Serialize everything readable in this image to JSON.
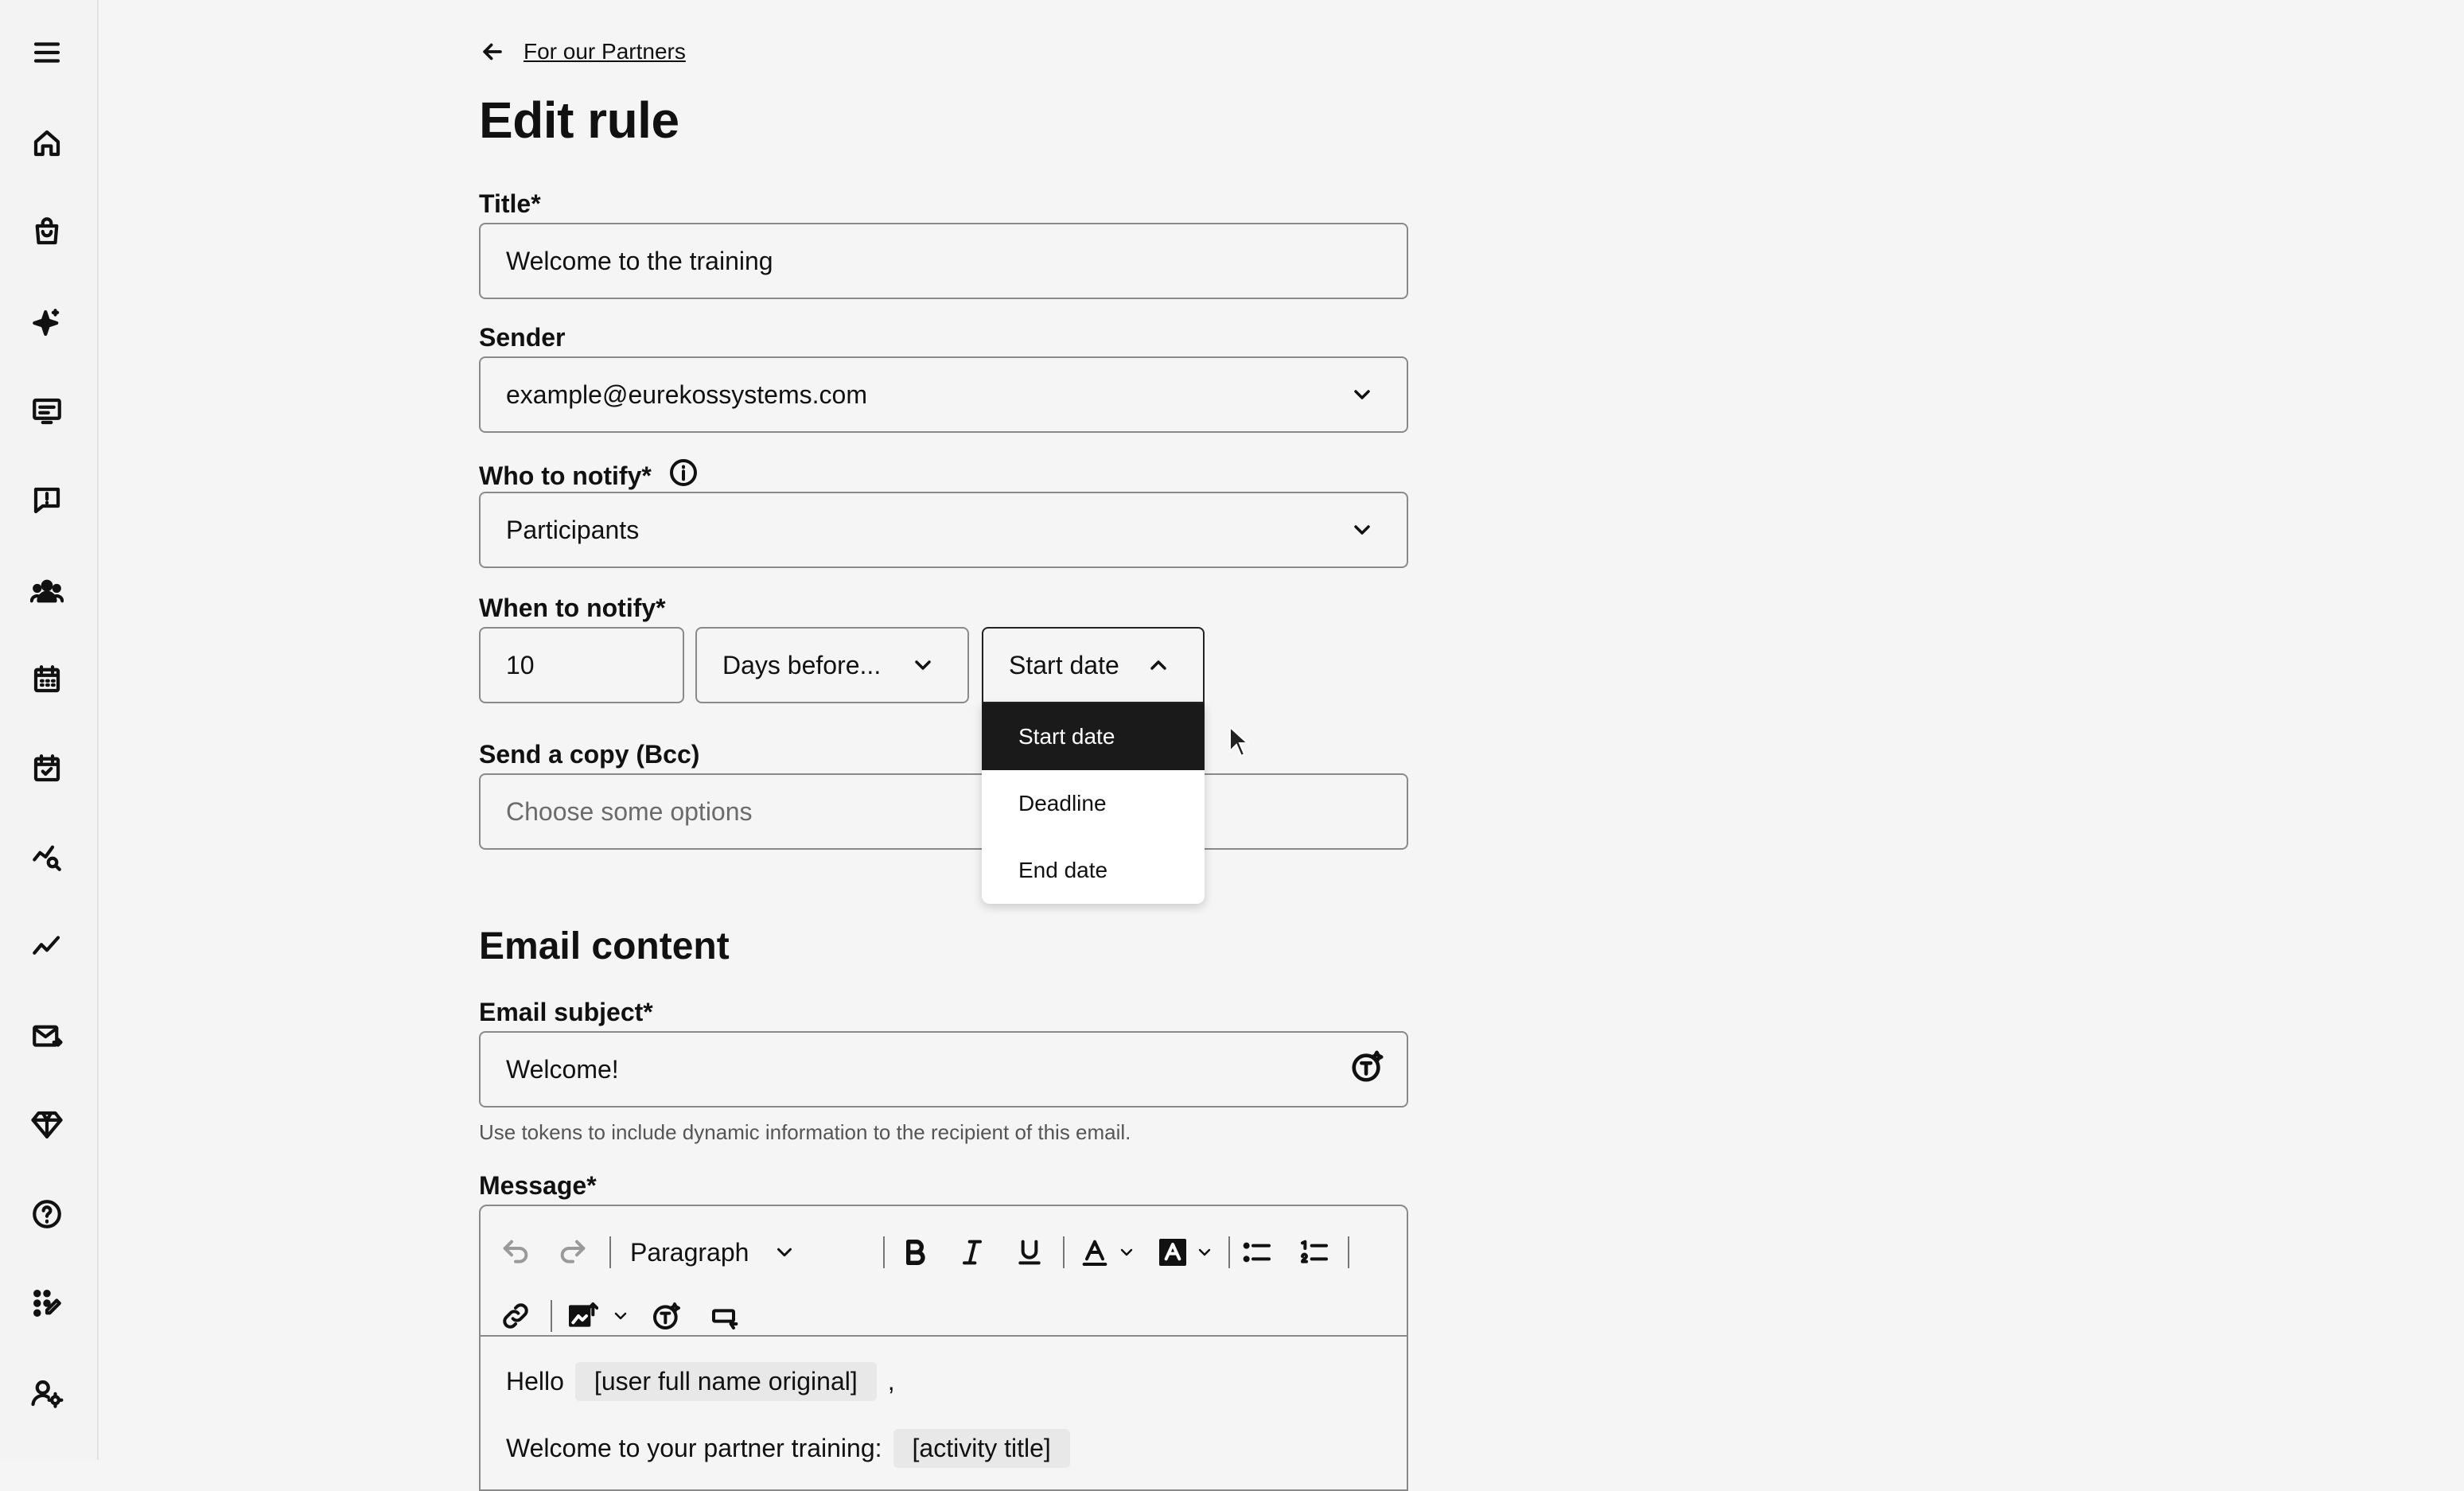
{
  "back": {
    "label": "For our Partners"
  },
  "page": {
    "title": "Edit rule"
  },
  "form": {
    "title_label": "Title*",
    "title_value": "Welcome to the training",
    "sender_label": "Sender",
    "sender_value": "example@eurekossystems.com",
    "notify_label": "Who to notify*",
    "notify_value": "Participants",
    "when_label": "When to notify*",
    "when_amount": "10",
    "when_unit": "Days before...",
    "when_ref": "Start date",
    "bcc_label": "Send a copy (Bcc)",
    "bcc_placeholder": "Choose some options"
  },
  "dropdown": {
    "options": [
      "Start date",
      "Deadline",
      "End date"
    ],
    "selected": "Start date"
  },
  "email": {
    "section_title": "Email content",
    "subject_label": "Email subject*",
    "subject_value": "Welcome!",
    "subject_help": "Use tokens to include dynamic information to the recipient of this email.",
    "message_label": "Message*",
    "toolbar_block_style": "Paragraph",
    "line1_prefix": "Hello",
    "line1_token": "[user full name original]",
    "line1_suffix": ",",
    "line2_prefix": "Welcome to your partner training:",
    "line2_token": "[activity title]"
  },
  "icons": {
    "sidebar": [
      "menu-icon",
      "home-icon",
      "shopping-bag-icon",
      "sparkles-icon",
      "presentation-icon",
      "message-alert-icon",
      "users-icon",
      "calendar-icon",
      "calendar-check-icon",
      "chart-search-icon",
      "trend-line-icon",
      "mail-send-icon",
      "diamond-icon",
      "help-circle-icon",
      "grid-edit-icon",
      "user-settings-icon"
    ]
  }
}
